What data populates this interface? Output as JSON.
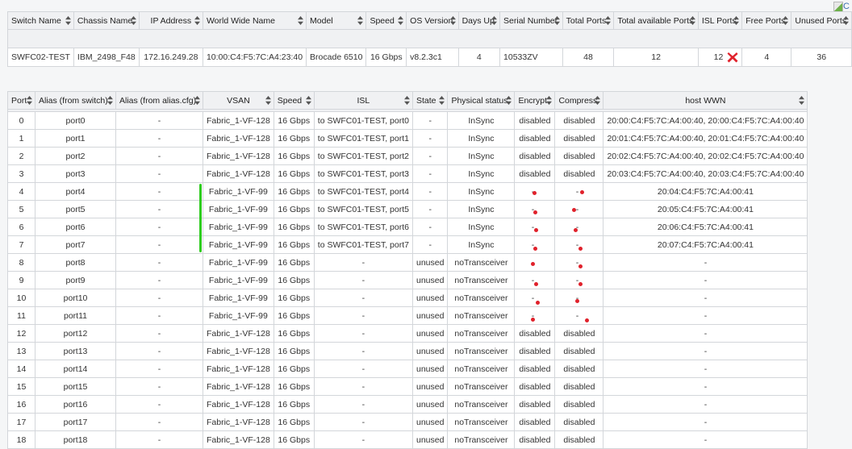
{
  "broken_image": {
    "alt_text": "C"
  },
  "switch_table": {
    "headers": [
      "Switch Name",
      "Chassis Name",
      "IP Address",
      "World Wide Name",
      "Model",
      "Speed",
      "OS Version",
      "Days Up",
      "Serial Number",
      "Total Ports",
      "Total available Ports",
      "ISL Ports",
      "Free Ports",
      "Unused Ports"
    ],
    "row": {
      "switch_name": "SWFC02-TEST",
      "chassis_name": "IBM_2498_F48",
      "ip_address": "172.16.249.28",
      "wwn": "10:00:C4:F5:7C:A4:23:40",
      "model": "Brocade 6510",
      "speed": "16 Gbps",
      "os_version": "v8.2.3c1",
      "days_up": "4",
      "serial_number": "10533ZV",
      "total_ports": "48",
      "total_available_ports": "12",
      "isl_ports": "12",
      "isl_ports_flag": "red-x-icon",
      "free_ports": "4",
      "unused_ports": "36"
    }
  },
  "port_table": {
    "headers": [
      "Port",
      "Alias (from switch)",
      "Alias (from alias.cfg)",
      "VSAN",
      "Speed",
      "ISL",
      "State",
      "Physical status",
      "Encrypt",
      "Compress",
      "host WWN"
    ],
    "rows": [
      {
        "port": "0",
        "alias_switch": "port0",
        "alias_cfg": "-",
        "vsan": "Fabric_1-VF-128",
        "speed": "16 Gbps",
        "isl": "to SWFC01-TEST, port0",
        "state": "-",
        "physical": "InSync",
        "encrypt": "disabled",
        "compress": "disabled",
        "host_wwn": "20:00:C4:F5:7C:A4:00:40, 20:00:C4:F5:7C:A4:00:40"
      },
      {
        "port": "1",
        "alias_switch": "port1",
        "alias_cfg": "-",
        "vsan": "Fabric_1-VF-128",
        "speed": "16 Gbps",
        "isl": "to SWFC01-TEST, port1",
        "state": "-",
        "physical": "InSync",
        "encrypt": "disabled",
        "compress": "disabled",
        "host_wwn": "20:01:C4:F5:7C:A4:00:40, 20:01:C4:F5:7C:A4:00:40"
      },
      {
        "port": "2",
        "alias_switch": "port2",
        "alias_cfg": "-",
        "vsan": "Fabric_1-VF-128",
        "speed": "16 Gbps",
        "isl": "to SWFC01-TEST, port2",
        "state": "-",
        "physical": "InSync",
        "encrypt": "disabled",
        "compress": "disabled",
        "host_wwn": "20:02:C4:F5:7C:A4:00:40, 20:02:C4:F5:7C:A4:00:40"
      },
      {
        "port": "3",
        "alias_switch": "port3",
        "alias_cfg": "-",
        "vsan": "Fabric_1-VF-128",
        "speed": "16 Gbps",
        "isl": "to SWFC01-TEST, port3",
        "state": "-",
        "physical": "InSync",
        "encrypt": "disabled",
        "compress": "disabled",
        "host_wwn": "20:03:C4:F5:7C:A4:00:40, 20:03:C4:F5:7C:A4:00:40"
      },
      {
        "port": "4",
        "alias_switch": "port4",
        "alias_cfg": "-",
        "vsan": "Fabric_1-VF-99",
        "speed": "16 Gbps",
        "isl": "to SWFC01-TEST, port4",
        "state": "-",
        "physical": "InSync",
        "encrypt": "-",
        "compress": "-",
        "host_wwn": "20:04:C4:F5:7C:A4:00:41",
        "red_marks": true
      },
      {
        "port": "5",
        "alias_switch": "port5",
        "alias_cfg": "-",
        "vsan": "Fabric_1-VF-99",
        "speed": "16 Gbps",
        "isl": "to SWFC01-TEST, port5",
        "state": "-",
        "physical": "InSync",
        "encrypt": "-",
        "compress": "-",
        "host_wwn": "20:05:C4:F5:7C:A4:00:41",
        "red_marks": true
      },
      {
        "port": "6",
        "alias_switch": "port6",
        "alias_cfg": "-",
        "vsan": "Fabric_1-VF-99",
        "speed": "16 Gbps",
        "isl": "to SWFC01-TEST, port6",
        "state": "-",
        "physical": "InSync",
        "encrypt": "-",
        "compress": "-",
        "host_wwn": "20:06:C4:F5:7C:A4:00:41",
        "red_marks": true
      },
      {
        "port": "7",
        "alias_switch": "port7",
        "alias_cfg": "-",
        "vsan": "Fabric_1-VF-99",
        "speed": "16 Gbps",
        "isl": "to SWFC01-TEST, port7",
        "state": "-",
        "physical": "InSync",
        "encrypt": "-",
        "compress": "-",
        "host_wwn": "20:07:C4:F5:7C:A4:00:41",
        "red_marks": true
      },
      {
        "port": "8",
        "alias_switch": "port8",
        "alias_cfg": "-",
        "vsan": "Fabric_1-VF-99",
        "speed": "16 Gbps",
        "isl": "-",
        "state": "unused",
        "physical": "noTransceiver",
        "encrypt": "-",
        "compress": "-",
        "host_wwn": "-",
        "red_marks": true
      },
      {
        "port": "9",
        "alias_switch": "port9",
        "alias_cfg": "-",
        "vsan": "Fabric_1-VF-99",
        "speed": "16 Gbps",
        "isl": "-",
        "state": "unused",
        "physical": "noTransceiver",
        "encrypt": "-",
        "compress": "-",
        "host_wwn": "-",
        "red_marks": true
      },
      {
        "port": "10",
        "alias_switch": "port10",
        "alias_cfg": "-",
        "vsan": "Fabric_1-VF-99",
        "speed": "16 Gbps",
        "isl": "-",
        "state": "unused",
        "physical": "noTransceiver",
        "encrypt": "-",
        "compress": "-",
        "host_wwn": "-",
        "red_marks": true
      },
      {
        "port": "11",
        "alias_switch": "port11",
        "alias_cfg": "-",
        "vsan": "Fabric_1-VF-99",
        "speed": "16 Gbps",
        "isl": "-",
        "state": "unused",
        "physical": "noTransceiver",
        "encrypt": "-",
        "compress": "-",
        "host_wwn": "-",
        "red_marks": true
      },
      {
        "port": "12",
        "alias_switch": "port12",
        "alias_cfg": "-",
        "vsan": "Fabric_1-VF-128",
        "speed": "16 Gbps",
        "isl": "-",
        "state": "unused",
        "physical": "noTransceiver",
        "encrypt": "disabled",
        "compress": "disabled",
        "host_wwn": "-"
      },
      {
        "port": "13",
        "alias_switch": "port13",
        "alias_cfg": "-",
        "vsan": "Fabric_1-VF-128",
        "speed": "16 Gbps",
        "isl": "-",
        "state": "unused",
        "physical": "noTransceiver",
        "encrypt": "disabled",
        "compress": "disabled",
        "host_wwn": "-"
      },
      {
        "port": "14",
        "alias_switch": "port14",
        "alias_cfg": "-",
        "vsan": "Fabric_1-VF-128",
        "speed": "16 Gbps",
        "isl": "-",
        "state": "unused",
        "physical": "noTransceiver",
        "encrypt": "disabled",
        "compress": "disabled",
        "host_wwn": "-"
      },
      {
        "port": "15",
        "alias_switch": "port15",
        "alias_cfg": "-",
        "vsan": "Fabric_1-VF-128",
        "speed": "16 Gbps",
        "isl": "-",
        "state": "unused",
        "physical": "noTransceiver",
        "encrypt": "disabled",
        "compress": "disabled",
        "host_wwn": "-"
      },
      {
        "port": "16",
        "alias_switch": "port16",
        "alias_cfg": "-",
        "vsan": "Fabric_1-VF-128",
        "speed": "16 Gbps",
        "isl": "-",
        "state": "unused",
        "physical": "noTransceiver",
        "encrypt": "disabled",
        "compress": "disabled",
        "host_wwn": "-"
      },
      {
        "port": "17",
        "alias_switch": "port17",
        "alias_cfg": "-",
        "vsan": "Fabric_1-VF-128",
        "speed": "16 Gbps",
        "isl": "-",
        "state": "unused",
        "physical": "noTransceiver",
        "encrypt": "disabled",
        "compress": "disabled",
        "host_wwn": "-"
      },
      {
        "port": "18",
        "alias_switch": "port18",
        "alias_cfg": "-",
        "vsan": "Fabric_1-VF-128",
        "speed": "16 Gbps",
        "isl": "-",
        "state": "unused",
        "physical": "noTransceiver",
        "encrypt": "disabled",
        "compress": "disabled",
        "host_wwn": "-"
      }
    ]
  },
  "colors": {
    "accent_red": "#e0212b",
    "marker_green": "#2ecc1f",
    "header_bg": "#f0f1f3",
    "border": "#d3d6da"
  }
}
